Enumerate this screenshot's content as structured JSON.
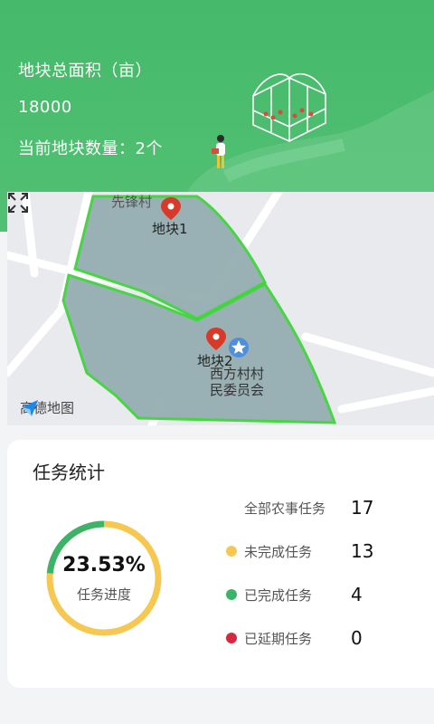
{
  "header": {
    "area_label": "地块总面积（亩）",
    "area_value": "18000",
    "count_line": "当前地块数量：2个",
    "accent": "#46b96a"
  },
  "map": {
    "plot1_label": "地块1",
    "plot2_label": "地块2",
    "village1": "先锋村",
    "committee_line1": "西方村村",
    "committee_line2": "民委员会",
    "provider": "高德地图",
    "plot_fill": "#95aeb1",
    "plot_border": "#3fd43a",
    "pin_color": "#d83a2a"
  },
  "tasks": {
    "title": "任务统计",
    "progress_value": "23.53%",
    "progress_label": "任务进度",
    "progress_fraction": 0.2353,
    "rows": [
      {
        "name": "全部农事任务",
        "count": "17",
        "color": ""
      },
      {
        "name": "未完成任务",
        "count": "13",
        "color": "#f6c851"
      },
      {
        "name": "已完成任务",
        "count": "4",
        "color": "#3db36a"
      },
      {
        "name": "已延期任务",
        "count": "0",
        "color": "#d8283f"
      }
    ]
  }
}
